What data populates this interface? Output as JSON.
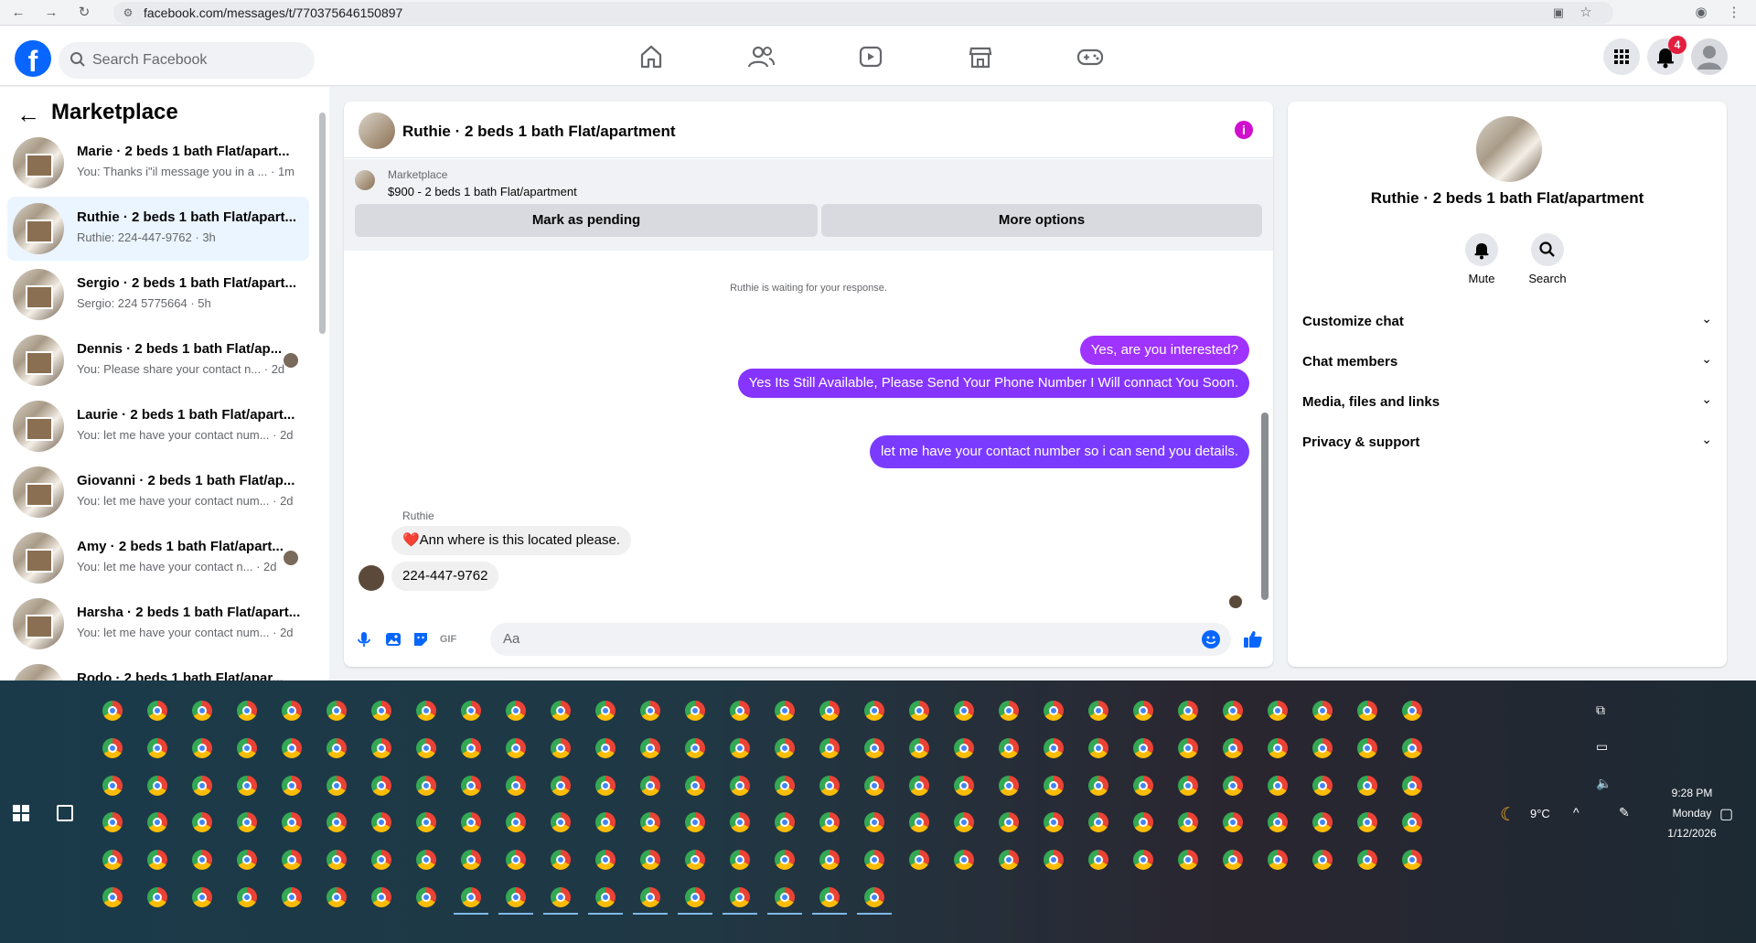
{
  "browser": {
    "url": "facebook.com/messages/t/770375646150897"
  },
  "header": {
    "logo": "f",
    "search_placeholder": "Search Facebook",
    "notification_count": "4"
  },
  "sidebar": {
    "title": "Marketplace",
    "conversations": [
      {
        "name": "Marie · 2 beds 1 bath Flat/apart...",
        "preview": "You: Thanks i\"il message you in a ... · 1m"
      },
      {
        "name": "Ruthie · 2 beds 1 bath Flat/apart...",
        "preview": "Ruthie: 224-447-9762 · 3h"
      },
      {
        "name": "Sergio · 2 beds 1 bath Flat/apart...",
        "preview": "Sergio: 224 5775664 · 5h"
      },
      {
        "name": "Dennis · 2 beds 1 bath Flat/ap...",
        "preview": "You: Please share your contact n... · 2d"
      },
      {
        "name": "Laurie · 2 beds 1 bath Flat/apart...",
        "preview": "You: let me have your contact num... · 2d"
      },
      {
        "name": "Giovanni · 2 beds 1 bath Flat/ap...",
        "preview": "You: let me have your contact num... · 2d"
      },
      {
        "name": "Amy · 2 beds 1 bath Flat/apart...",
        "preview": "You: let me have your contact n... · 2d"
      },
      {
        "name": "Harsha · 2 beds 1 bath Flat/apart...",
        "preview": "You: let me have your contact num... · 2d"
      },
      {
        "name": "Rodo · 2 beds 1 bath Flat/apar...",
        "preview": ""
      }
    ]
  },
  "chat": {
    "title": "Ruthie · 2 beds 1 bath Flat/apartment",
    "marketplace_label": "Marketplace",
    "listing": "$900 - 2 beds 1 bath Flat/apartment",
    "mark_pending": "Mark as pending",
    "more_options": "More options",
    "waiting": "Ruthie is waiting for your response.",
    "outgoing": [
      "Yes, are you interested?",
      "Yes Its Still Available, Please Send Your Phone Number I Will connact You Soon.",
      "let me have your contact number so i can send you details."
    ],
    "sender": "Ruthie",
    "incoming": [
      "❤️Ann where is this located please.",
      "224-447-9762"
    ],
    "composer_placeholder": "Aa"
  },
  "details": {
    "title": "Ruthie · 2 beds 1 bath Flat/apartment",
    "mute": "Mute",
    "search": "Search",
    "sections": [
      "Customize chat",
      "Chat members",
      "Media, files and links",
      "Privacy & support"
    ]
  },
  "taskbar": {
    "weather": "9°C",
    "time": "9:28 PM",
    "day": "Monday",
    "date": "1/12/2026"
  },
  "colors": {
    "fb_blue": "#0866ff",
    "outgoing_bubble": "#a033ff",
    "notification_red": "#e41e3f"
  }
}
